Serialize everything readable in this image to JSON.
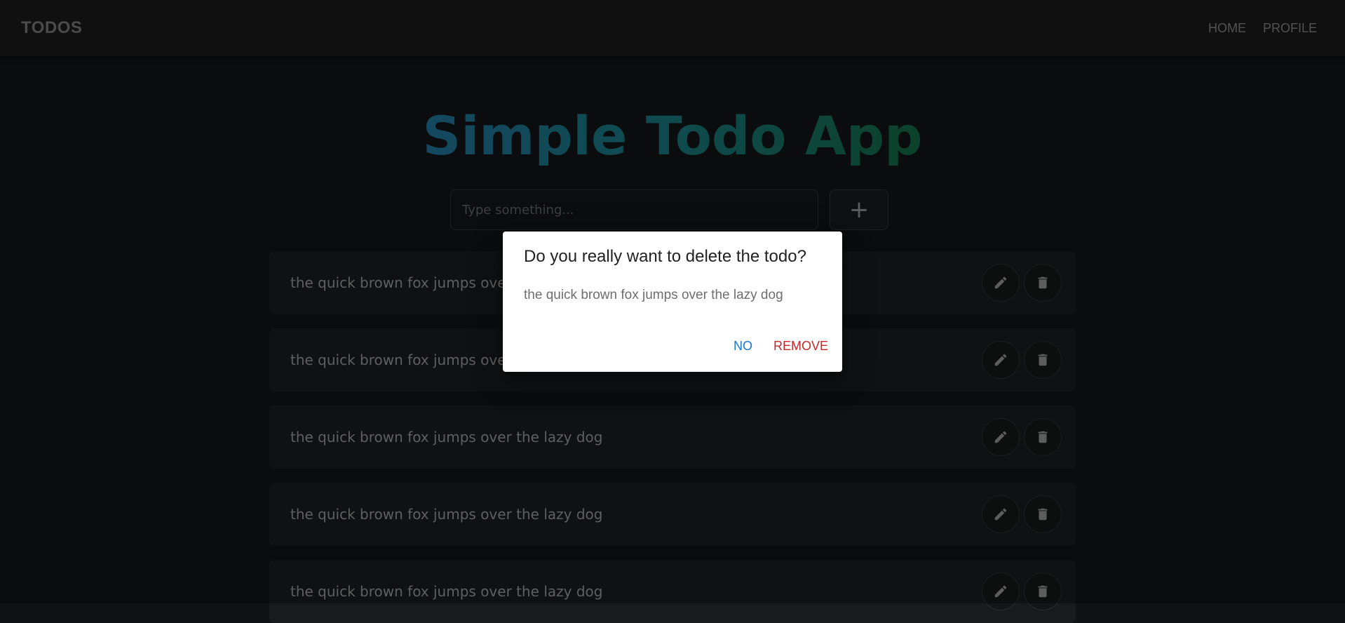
{
  "appbar": {
    "brand": "TODOS",
    "nav": [
      {
        "label": "HOME"
      },
      {
        "label": "PROFILE"
      }
    ]
  },
  "header": {
    "title": "Simple Todo App"
  },
  "new_todo": {
    "placeholder": "Type something...",
    "add_icon": "plus-icon",
    "add_glyph": "+"
  },
  "todos": [
    {
      "text": "the quick brown fox jumps over the lazy dog"
    },
    {
      "text": "the quick brown fox jumps over the lazy dog"
    },
    {
      "text": "the quick brown fox jumps over the lazy dog"
    },
    {
      "text": "the quick brown fox jumps over the lazy dog"
    },
    {
      "text": "the quick brown fox jumps over the lazy dog"
    }
  ],
  "todo_actions": {
    "edit_icon": "pencil-icon",
    "delete_icon": "trash-icon"
  },
  "dialog": {
    "title": "Do you really want to delete the todo?",
    "content": "the quick brown fox jumps over the lazy dog",
    "cancel_label": "NO",
    "confirm_label": "REMOVE"
  },
  "colors": {
    "background": "#101214",
    "appbar": "#191919",
    "title_gradient_start": "#1d6a8e",
    "title_gradient_end": "#12613f",
    "dialog_cancel": "#1976d2",
    "dialog_confirm": "#c62828"
  }
}
